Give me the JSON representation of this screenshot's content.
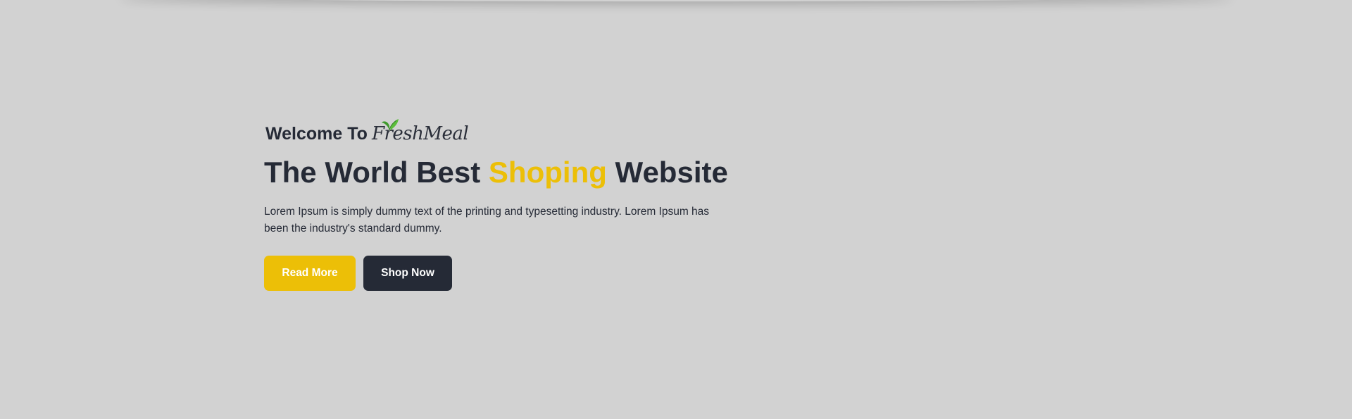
{
  "hero": {
    "welcome_prefix": "Welcome To",
    "logo_text": "FreshMeal",
    "headline_part1": "The World Best ",
    "headline_accent": "Shoping",
    "headline_part2": " Website",
    "description": "Lorem Ipsum is simply dummy text of the printing and typesetting industry. Lorem Ipsum has been the industry's standard dummy.",
    "read_more_label": "Read More",
    "shop_now_label": "Shop Now"
  },
  "colors": {
    "background": "#d2d2d2",
    "accent": "#ecbf07",
    "dark": "#252a36",
    "leaf": "#4caf3a"
  },
  "icons": {
    "logo_leaf": "leaf-icon"
  }
}
